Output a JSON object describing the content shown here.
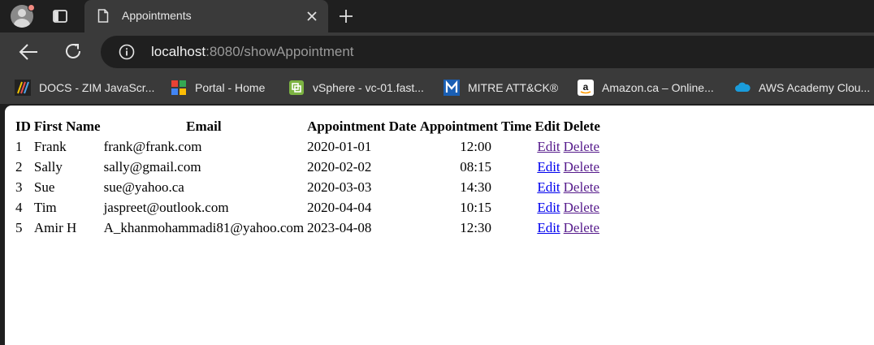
{
  "browser": {
    "tab_title": "Appointments",
    "url_host": "localhost",
    "url_rest": ":8080/showAppointment"
  },
  "bookmarks": [
    {
      "label": "DOCS - ZIM JavaScr...",
      "icon": "zim-docs-icon"
    },
    {
      "label": "Portal - Home",
      "icon": "portal-grid-icon"
    },
    {
      "label": "vSphere - vc-01.fast...",
      "icon": "vsphere-icon"
    },
    {
      "label": "MITRE ATT&CK®",
      "icon": "mitre-icon"
    },
    {
      "label": "Amazon.ca – Online...",
      "icon": "amazon-icon"
    },
    {
      "label": "AWS Academy Clou...",
      "icon": "aws-cloud-icon"
    }
  ],
  "table": {
    "headers": [
      "ID",
      "First Name",
      "Email",
      "Appointment Date",
      "Appointment Time",
      "Edit",
      "Delete"
    ],
    "rows": [
      {
        "id": "1",
        "first_name": "Frank",
        "email": "frank@frank.com",
        "date": "2020-01-01",
        "time": "12:00",
        "edit": "Edit",
        "delete": "Delete"
      },
      {
        "id": "2",
        "first_name": "Sally",
        "email": "sally@gmail.com",
        "date": "2020-02-02",
        "time": "08:15",
        "edit": "Edit",
        "delete": "Delete"
      },
      {
        "id": "3",
        "first_name": "Sue",
        "email": "sue@yahoo.ca",
        "date": "2020-03-03",
        "time": "14:30",
        "edit": "Edit",
        "delete": "Delete"
      },
      {
        "id": "4",
        "first_name": "Tim",
        "email": "jaspreet@outlook.com",
        "date": "2020-04-04",
        "time": "10:15",
        "edit": "Edit",
        "delete": "Delete"
      },
      {
        "id": "5",
        "first_name": "Amir H",
        "email": "A_khanmohammadi81@yahoo.com",
        "date": "2023-04-08",
        "time": "12:30",
        "edit": "Edit",
        "delete": "Delete"
      }
    ]
  },
  "colors": {
    "link_visited": "#551a8b",
    "link_unvisited": "#0000ee",
    "browser_dark": "#1f1f1f",
    "toolbar": "#3a3a3a"
  }
}
